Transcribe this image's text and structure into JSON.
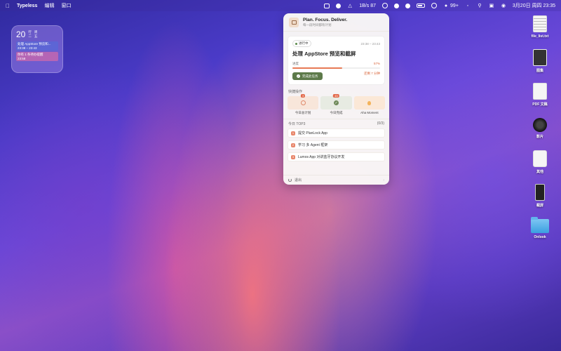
{
  "menubar": {
    "app": "Typeless",
    "menus": [
      "编辑",
      "窗口"
    ],
    "speed": "1B/s",
    "speed2": "87",
    "notifications": "99+",
    "datetime": "3月20日 周四 23:35"
  },
  "calendar_widget": {
    "day": "20",
    "weekday1": "行",
    "weekday2": "周",
    "weekday3": "二",
    "weekday4": "五",
    "event1_title": "处理 AppStore 预览和...",
    "event1_time": "23:38 – 23:43",
    "event2_title": "你有 1 条待办提醒",
    "event2_time": "23:58"
  },
  "popover": {
    "title": "Plan. Focus. Deliver.",
    "subtitle": "每一段时间都有计划",
    "task": {
      "status": "进行中",
      "time": "23:38 – 23:43",
      "title": "处理 AppStore 预览和截屏",
      "progress_label": "进度",
      "progress_pct": "57%",
      "progress_value": 0.57,
      "more": "还剩 7 分钟",
      "complete_label": "完成此任务"
    },
    "quick_title": "快捷操作",
    "quick": [
      {
        "label": "今日总计划",
        "badge": "3",
        "icon": "target-icon"
      },
      {
        "label": "今日完成",
        "badge": "45",
        "icon": "check-icon"
      },
      {
        "label": "Aha Moment",
        "badge": "",
        "icon": "bulb-icon"
      }
    ],
    "top3_title": "今日 TOP3",
    "top3_count": "(0/3)",
    "top3": [
      {
        "num": "1",
        "text": "提交 PlanLock App"
      },
      {
        "num": "2",
        "text": "学习 多 Agent 框架"
      },
      {
        "num": "3",
        "text": "Lumos App 对讲蓝牙协议开发"
      }
    ],
    "footer_label": "退出"
  },
  "desktop_icons": [
    {
      "label": "file_list.txt"
    },
    {
      "label": "图集"
    },
    {
      "label": "PDF 文稿"
    },
    {
      "label": "影片"
    },
    {
      "label": "其他"
    },
    {
      "label": "截屏"
    },
    {
      "label": "Onlook"
    }
  ]
}
